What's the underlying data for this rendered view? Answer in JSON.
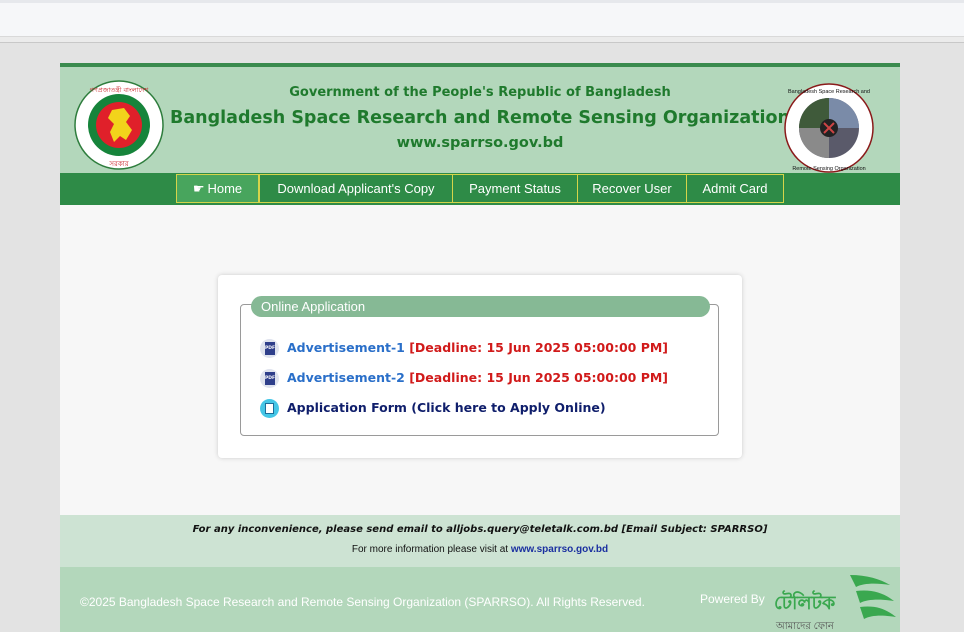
{
  "header": {
    "gov_title": "Government of the People's Republic of Bangladesh",
    "org_title": "Bangladesh Space Research and Remote Sensing Organization",
    "url": "www.sparrso.gov.bd",
    "left_logo_text_top": "গণপ্রজাতন্ত্রী বাংলাদেশ",
    "left_logo_text_bottom": "সরকার",
    "right_logo_text_top": "Bangladesh Space Research and",
    "right_logo_text_bottom": "Remote Sensing Organization"
  },
  "nav": {
    "items": [
      {
        "label": "Home",
        "icon": "hand-point-right-icon",
        "active": true
      },
      {
        "label": "Download Applicant's Copy"
      },
      {
        "label": "Payment Status"
      },
      {
        "label": "Recover User"
      },
      {
        "label": "Admit Card"
      }
    ]
  },
  "online_application": {
    "legend": "Online Application",
    "items": [
      {
        "icon": "pdf-icon",
        "link": "Advertisement-1",
        "deadline": "[Deadline: 15 Jun 2025 05:00:00 PM]"
      },
      {
        "icon": "pdf-icon",
        "link": "Advertisement-2",
        "deadline": "[Deadline: 15 Jun 2025 05:00:00 PM]"
      },
      {
        "icon": "form-icon",
        "link": "Application Form (Click here to Apply Online)"
      }
    ]
  },
  "footer": {
    "message": "For any inconvenience, please send email to alljobs.query@teletalk.com.bd [Email Subject: SPARRSO]",
    "info_prefix": "For more information please visit at ",
    "info_link": "www.sparrso.gov.bd",
    "copyright": "©2025 Bangladesh Space Research and Remote Sensing Organization (SPARRSO). All Rights Reserved.",
    "powered_by": "Powered By",
    "brand_name": "টেলিটক",
    "brand_tagline": "আমাদের ফোন"
  },
  "colors": {
    "header_bg": "#b3d7bb",
    "nav_bg": "#2e8b47",
    "title_green": "#1f7a2d",
    "deadline_red": "#d11a1a",
    "link_blue": "#2a6fc9"
  }
}
